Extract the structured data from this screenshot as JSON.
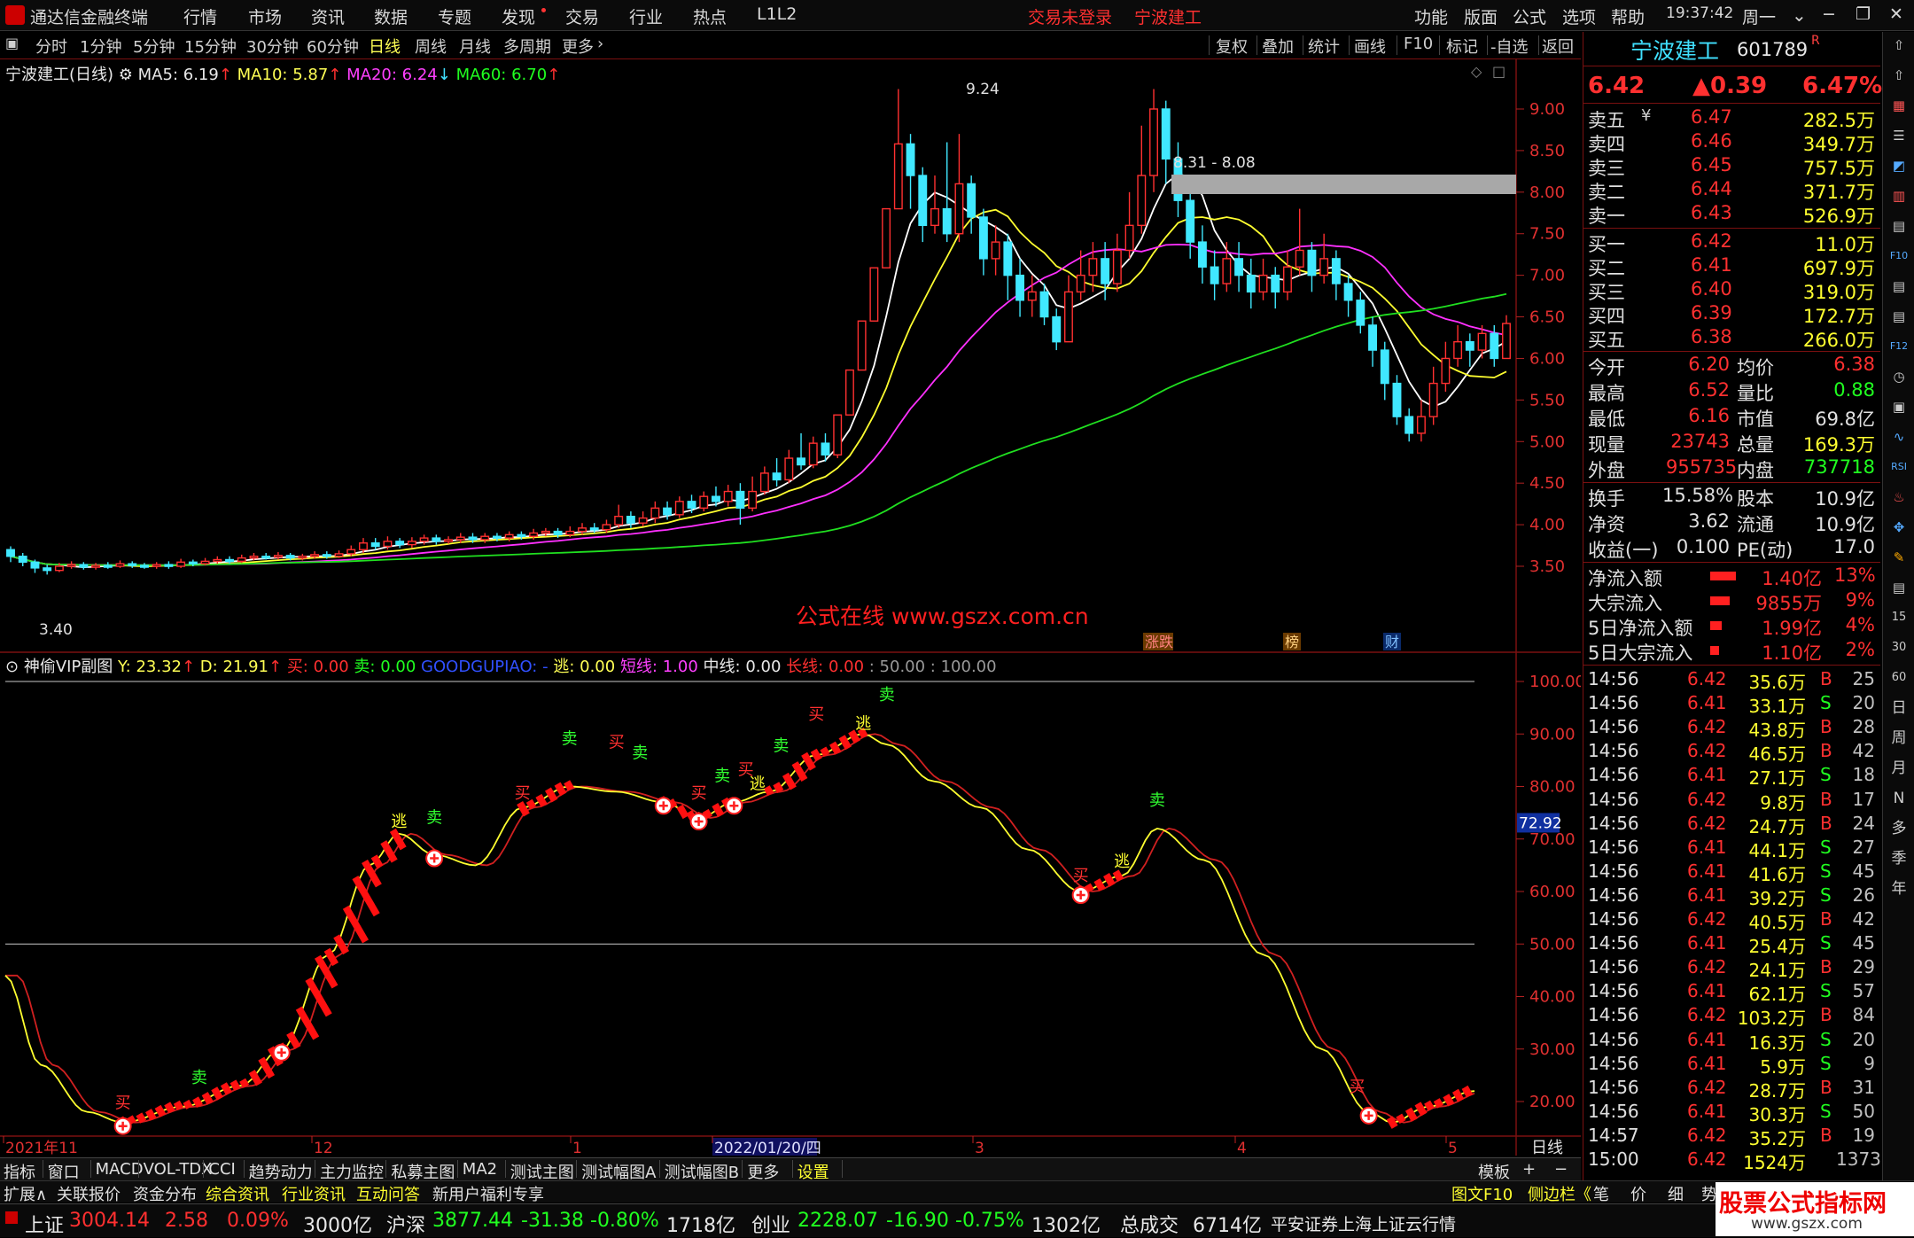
{
  "titlebar": {
    "app_name": "通达信金融终端",
    "menus": [
      "行情",
      "市场",
      "资讯",
      "数据",
      "专题",
      "发现",
      "交易",
      "行业",
      "热点",
      "L1L2"
    ],
    "login_status": "交易未登录",
    "stock_name": "宁波建工",
    "right_menus": [
      "功能",
      "版面",
      "公式",
      "选项",
      "帮助"
    ],
    "time": "19:37:42",
    "weekday": "周一"
  },
  "period_toolbar": {
    "items": [
      "分时",
      "1分钟",
      "5分钟",
      "15分钟",
      "30分钟",
      "60分钟",
      "日线",
      "周线",
      "月线",
      "多周期",
      "更多"
    ],
    "selected": "日线",
    "right_items": [
      "复权",
      "叠加",
      "统计",
      "画线",
      "F10",
      "标记",
      "-自选",
      "返回"
    ]
  },
  "main_legend": {
    "title": "宁波建工(日线)",
    "ma5": "MA5: 6.19",
    "ma10": "MA10: 5.87",
    "ma20": "MA20: 6.24",
    "ma60": "MA60: 6.70"
  },
  "main_chart": {
    "y_ticks": [
      "9.00",
      "8.50",
      "8.00",
      "7.50",
      "7.00",
      "6.50",
      "6.00",
      "5.50",
      "5.00",
      "4.50",
      "4.00",
      "3.50"
    ],
    "high_label": "9.24",
    "low_label": "3.40",
    "range_label": "8.31 - 8.08",
    "watermark": "公式在线  www.gszx.com.cn",
    "event_tags": [
      "涨跌",
      "榜",
      "财"
    ]
  },
  "sub_legend": {
    "title": "神偷VIP副图",
    "y": "Y: 23.32",
    "d": "D: 21.91",
    "buy": "买: 0.00",
    "sell": "卖: 0.00",
    "gg": "GOODGUPIAO: -",
    "escape": "逃: 0.00",
    "short": "短线: 1.00",
    "mid": "中线: 0.00",
    "long": "长线: 0.00",
    "levels": ": 50.00 : 100.00"
  },
  "sub_chart": {
    "y_ticks": [
      "100.00",
      "90.00",
      "80.00",
      "70.00",
      "60.00",
      "50.00",
      "40.00",
      "30.00",
      "20.00"
    ],
    "current_value": "72.92",
    "buy_text": "买",
    "sell_text": "卖",
    "escape_text": "逃"
  },
  "x_axis": {
    "labels": [
      "2021年11",
      "12",
      "1",
      "2022/01/20/四",
      "3",
      "4",
      "5"
    ],
    "period": "日线"
  },
  "chart_data": {
    "type": "candlestick",
    "title": "宁波建工(日线)",
    "y_range": [
      3.2,
      9.5
    ],
    "ma_values": {
      "MA5": 6.19,
      "MA10": 5.87,
      "MA20": 6.24,
      "MA60": 6.7
    },
    "extremes": {
      "high": 9.24,
      "low": 3.4
    },
    "candles": [
      [
        3.7,
        3.62,
        3.74,
        3.55
      ],
      [
        3.62,
        3.55,
        3.66,
        3.5
      ],
      [
        3.55,
        3.48,
        3.58,
        3.42
      ],
      [
        3.48,
        3.45,
        3.52,
        3.4
      ],
      [
        3.45,
        3.5,
        3.54,
        3.43
      ],
      [
        3.5,
        3.52,
        3.56,
        3.47
      ],
      [
        3.52,
        3.49,
        3.55,
        3.46
      ],
      [
        3.49,
        3.51,
        3.54,
        3.46
      ],
      [
        3.51,
        3.5,
        3.55,
        3.47
      ],
      [
        3.5,
        3.53,
        3.57,
        3.48
      ],
      [
        3.53,
        3.51,
        3.56,
        3.48
      ],
      [
        3.51,
        3.5,
        3.54,
        3.47
      ],
      [
        3.5,
        3.52,
        3.55,
        3.47
      ],
      [
        3.52,
        3.5,
        3.56,
        3.47
      ],
      [
        3.5,
        3.55,
        3.59,
        3.48
      ],
      [
        3.55,
        3.53,
        3.58,
        3.5
      ],
      [
        3.53,
        3.56,
        3.6,
        3.51
      ],
      [
        3.56,
        3.58,
        3.62,
        3.53
      ],
      [
        3.58,
        3.56,
        3.62,
        3.53
      ],
      [
        3.56,
        3.6,
        3.64,
        3.54
      ],
      [
        3.6,
        3.62,
        3.66,
        3.57
      ],
      [
        3.62,
        3.61,
        3.66,
        3.58
      ],
      [
        3.61,
        3.63,
        3.67,
        3.58
      ],
      [
        3.63,
        3.6,
        3.66,
        3.57
      ],
      [
        3.6,
        3.62,
        3.65,
        3.57
      ],
      [
        3.62,
        3.64,
        3.68,
        3.59
      ],
      [
        3.64,
        3.62,
        3.68,
        3.59
      ],
      [
        3.62,
        3.65,
        3.69,
        3.6
      ],
      [
        3.65,
        3.7,
        3.75,
        3.62
      ],
      [
        3.7,
        3.78,
        3.84,
        3.66
      ],
      [
        3.78,
        3.74,
        3.84,
        3.7
      ],
      [
        3.74,
        3.8,
        3.86,
        3.7
      ],
      [
        3.8,
        3.76,
        3.84,
        3.72
      ],
      [
        3.76,
        3.8,
        3.85,
        3.72
      ],
      [
        3.8,
        3.84,
        3.88,
        3.76
      ],
      [
        3.84,
        3.8,
        3.88,
        3.76
      ],
      [
        3.8,
        3.82,
        3.86,
        3.77
      ],
      [
        3.82,
        3.85,
        3.9,
        3.78
      ],
      [
        3.85,
        3.82,
        3.9,
        3.78
      ],
      [
        3.82,
        3.86,
        3.9,
        3.78
      ],
      [
        3.86,
        3.84,
        3.9,
        3.8
      ],
      [
        3.84,
        3.88,
        3.92,
        3.8
      ],
      [
        3.88,
        3.86,
        3.92,
        3.82
      ],
      [
        3.86,
        3.9,
        3.95,
        3.82
      ],
      [
        3.9,
        3.92,
        3.96,
        3.86
      ],
      [
        3.92,
        3.88,
        3.96,
        3.84
      ],
      [
        3.88,
        3.92,
        3.98,
        3.85
      ],
      [
        3.92,
        3.96,
        4.02,
        3.88
      ],
      [
        3.96,
        3.94,
        4.02,
        3.9
      ],
      [
        3.94,
        4.0,
        4.06,
        3.9
      ],
      [
        4.0,
        4.1,
        4.24,
        3.96
      ],
      [
        4.1,
        4.02,
        4.16,
        3.96
      ],
      [
        4.02,
        4.08,
        4.16,
        3.98
      ],
      [
        4.08,
        4.2,
        4.28,
        4.02
      ],
      [
        4.2,
        4.12,
        4.28,
        4.06
      ],
      [
        4.12,
        4.28,
        4.34,
        4.08
      ],
      [
        4.28,
        4.2,
        4.36,
        4.14
      ],
      [
        4.2,
        4.34,
        4.4,
        4.16
      ],
      [
        4.34,
        4.28,
        4.46,
        4.22
      ],
      [
        4.28,
        4.4,
        4.48,
        4.22
      ],
      [
        4.4,
        4.2,
        4.5,
        4.0
      ],
      [
        4.2,
        4.4,
        4.58,
        4.16
      ],
      [
        4.4,
        4.62,
        4.7,
        4.36
      ],
      [
        4.62,
        4.54,
        4.8,
        4.46
      ],
      [
        4.54,
        4.8,
        4.9,
        4.5
      ],
      [
        4.8,
        4.72,
        5.1,
        4.66
      ],
      [
        4.72,
        4.98,
        5.06,
        4.68
      ],
      [
        4.98,
        4.84,
        5.1,
        4.76
      ],
      [
        4.84,
        5.32,
        5.32,
        4.8
      ],
      [
        5.32,
        5.86,
        5.86,
        5.32
      ],
      [
        5.86,
        6.45,
        6.45,
        5.86
      ],
      [
        6.45,
        7.09,
        7.09,
        6.45
      ],
      [
        7.09,
        7.8,
        7.8,
        7.09
      ],
      [
        7.8,
        8.58,
        9.24,
        7.8
      ],
      [
        8.58,
        8.2,
        8.7,
        7.8
      ],
      [
        8.2,
        7.6,
        8.3,
        7.4
      ],
      [
        7.6,
        7.8,
        8.2,
        7.5
      ],
      [
        7.8,
        7.5,
        8.6,
        7.4
      ],
      [
        7.5,
        8.1,
        8.7,
        7.4
      ],
      [
        8.1,
        7.7,
        8.2,
        7.5
      ],
      [
        7.7,
        7.2,
        7.8,
        7.0
      ],
      [
        7.2,
        7.4,
        7.6,
        7.0
      ],
      [
        7.4,
        7.0,
        7.5,
        6.7
      ],
      [
        7.0,
        6.7,
        7.2,
        6.5
      ],
      [
        6.7,
        6.8,
        7.0,
        6.5
      ],
      [
        6.8,
        6.5,
        6.9,
        6.4
      ],
      [
        6.5,
        6.2,
        6.6,
        6.1
      ],
      [
        6.2,
        6.8,
        7.0,
        6.2
      ],
      [
        6.8,
        7.0,
        7.3,
        6.7
      ],
      [
        7.0,
        7.2,
        7.4,
        6.8
      ],
      [
        7.2,
        6.9,
        7.4,
        6.7
      ],
      [
        6.9,
        7.3,
        7.5,
        6.8
      ],
      [
        7.3,
        7.6,
        8.0,
        7.2
      ],
      [
        7.6,
        8.2,
        8.8,
        7.5
      ],
      [
        8.2,
        9.0,
        9.24,
        8.0
      ],
      [
        9.0,
        8.4,
        9.1,
        8.1
      ],
      [
        8.4,
        7.9,
        8.6,
        7.7
      ],
      [
        7.9,
        7.4,
        8.0,
        7.2
      ],
      [
        7.4,
        7.1,
        7.6,
        6.9
      ],
      [
        7.1,
        6.9,
        7.3,
        6.7
      ],
      [
        6.9,
        7.2,
        7.4,
        6.8
      ],
      [
        7.2,
        7.0,
        7.4,
        6.8
      ],
      [
        7.0,
        6.8,
        7.2,
        6.6
      ],
      [
        6.8,
        7.0,
        7.2,
        6.7
      ],
      [
        7.0,
        6.8,
        7.1,
        6.6
      ],
      [
        6.8,
        7.1,
        7.3,
        6.7
      ],
      [
        7.1,
        7.3,
        7.8,
        7.0
      ],
      [
        7.3,
        7.0,
        7.4,
        6.8
      ],
      [
        7.0,
        7.2,
        7.5,
        6.9
      ],
      [
        7.2,
        6.9,
        7.3,
        6.7
      ],
      [
        6.9,
        6.7,
        7.0,
        6.5
      ],
      [
        6.7,
        6.4,
        6.8,
        6.3
      ],
      [
        6.4,
        6.1,
        6.5,
        5.9
      ],
      [
        6.1,
        5.7,
        6.2,
        5.5
      ],
      [
        5.7,
        5.3,
        5.8,
        5.2
      ],
      [
        5.3,
        5.1,
        5.4,
        5.0
      ],
      [
        5.1,
        5.3,
        5.5,
        5.0
      ],
      [
        5.3,
        5.7,
        5.9,
        5.2
      ],
      [
        5.7,
        6.0,
        6.2,
        5.6
      ],
      [
        6.0,
        6.2,
        6.4,
        5.9
      ],
      [
        6.2,
        6.1,
        6.3,
        5.9
      ],
      [
        6.1,
        6.3,
        6.4,
        6.0
      ],
      [
        6.3,
        6.0,
        6.4,
        5.9
      ],
      [
        6.0,
        6.42,
        6.52,
        6.0
      ]
    ],
    "indicator": {
      "name": "神偷VIP副图",
      "y_range": [
        15,
        100
      ],
      "Y": 23.32,
      "D": 21.91,
      "levels": [
        50,
        100
      ]
    }
  },
  "quote_panel": {
    "name": "宁波建工",
    "code": "601789",
    "flag": "R",
    "price": "6.42",
    "change": "▲0.39",
    "change_pct": "6.47%",
    "asks": [
      {
        "label": "卖五",
        "price": "6.47",
        "vol": "282.5万"
      },
      {
        "label": "卖四",
        "price": "6.46",
        "vol": "349.7万"
      },
      {
        "label": "卖三",
        "price": "6.45",
        "vol": "757.5万"
      },
      {
        "label": "卖二",
        "price": "6.44",
        "vol": "371.7万"
      },
      {
        "label": "卖一",
        "price": "6.43",
        "vol": "526.9万"
      }
    ],
    "bids": [
      {
        "label": "买一",
        "price": "6.42",
        "vol": "11.0万"
      },
      {
        "label": "买二",
        "price": "6.41",
        "vol": "697.9万"
      },
      {
        "label": "买三",
        "price": "6.40",
        "vol": "319.0万"
      },
      {
        "label": "买四",
        "price": "6.39",
        "vol": "172.7万"
      },
      {
        "label": "买五",
        "price": "6.38",
        "vol": "266.0万"
      }
    ],
    "stats": [
      {
        "l1": "今开",
        "v1": "6.20",
        "l2": "均价",
        "v2": "6.38"
      },
      {
        "l1": "最高",
        "v1": "6.52",
        "l2": "量比",
        "v2": "0.88"
      },
      {
        "l1": "最低",
        "v1": "6.16",
        "l2": "市值",
        "v2": "69.8亿"
      },
      {
        "l1": "现量",
        "v1": "23743",
        "l2": "总量",
        "v2": "169.3万"
      },
      {
        "l1": "外盘",
        "v1": "955735",
        "l2": "内盘",
        "v2": "737718"
      }
    ],
    "fund": [
      {
        "l1": "换手",
        "v1": "15.58%",
        "l2": "股本",
        "v2": "10.9亿"
      },
      {
        "l1": "净资",
        "v1": "3.62",
        "l2": "流通",
        "v2": "10.9亿"
      },
      {
        "l1": "收益(一)",
        "v1": "0.100",
        "l2": "PE(动)",
        "v2": "17.0"
      }
    ],
    "flows": [
      {
        "label": "净流入额",
        "value": "1.40亿",
        "pct": "13%",
        "bar": 0.13
      },
      {
        "label": "大宗流入",
        "value": "9855万",
        "pct": "9%",
        "bar": 0.09
      },
      {
        "label": "5日净流入额",
        "value": "1.99亿",
        "pct": "4%",
        "bar": 0.04
      },
      {
        "label": "5日大宗流入",
        "value": "1.10亿",
        "pct": "2%",
        "bar": 0.02
      }
    ],
    "ticks": [
      {
        "t": "14:56",
        "p": "6.42",
        "v": "35.6万",
        "bs": "B",
        "n": "25"
      },
      {
        "t": "14:56",
        "p": "6.41",
        "v": "33.1万",
        "bs": "S",
        "n": "20"
      },
      {
        "t": "14:56",
        "p": "6.42",
        "v": "43.8万",
        "bs": "B",
        "n": "28"
      },
      {
        "t": "14:56",
        "p": "6.42",
        "v": "46.5万",
        "bs": "B",
        "n": "42"
      },
      {
        "t": "14:56",
        "p": "6.41",
        "v": "27.1万",
        "bs": "S",
        "n": "18"
      },
      {
        "t": "14:56",
        "p": "6.42",
        "v": "9.8万",
        "bs": "B",
        "n": "17"
      },
      {
        "t": "14:56",
        "p": "6.42",
        "v": "24.7万",
        "bs": "B",
        "n": "24"
      },
      {
        "t": "14:56",
        "p": "6.41",
        "v": "44.1万",
        "bs": "S",
        "n": "27"
      },
      {
        "t": "14:56",
        "p": "6.41",
        "v": "41.6万",
        "bs": "S",
        "n": "45"
      },
      {
        "t": "14:56",
        "p": "6.41",
        "v": "39.2万",
        "bs": "S",
        "n": "26"
      },
      {
        "t": "14:56",
        "p": "6.42",
        "v": "40.5万",
        "bs": "B",
        "n": "42"
      },
      {
        "t": "14:56",
        "p": "6.41",
        "v": "25.4万",
        "bs": "S",
        "n": "45"
      },
      {
        "t": "14:56",
        "p": "6.42",
        "v": "24.1万",
        "bs": "B",
        "n": "29"
      },
      {
        "t": "14:56",
        "p": "6.41",
        "v": "62.1万",
        "bs": "S",
        "n": "57"
      },
      {
        "t": "14:56",
        "p": "6.42",
        "v": "103.2万",
        "bs": "B",
        "n": "84"
      },
      {
        "t": "14:56",
        "p": "6.41",
        "v": "16.3万",
        "bs": "S",
        "n": "20"
      },
      {
        "t": "14:56",
        "p": "6.41",
        "v": "5.9万",
        "bs": "S",
        "n": "9"
      },
      {
        "t": "14:56",
        "p": "6.42",
        "v": "28.7万",
        "bs": "B",
        "n": "31"
      },
      {
        "t": "14:56",
        "p": "6.41",
        "v": "30.3万",
        "bs": "S",
        "n": "50"
      },
      {
        "t": "14:57",
        "p": "6.42",
        "v": "35.2万",
        "bs": "B",
        "n": "19"
      },
      {
        "t": "15:00",
        "p": "6.42",
        "v": "1524万",
        "bs": "",
        "n": "1373"
      }
    ]
  },
  "bottom_tabs": {
    "items": [
      "指标",
      "窗口",
      "MACD",
      "VOL-TDX",
      "CCI",
      "趋势动力",
      "主力监控",
      "私募主图",
      "MA2",
      "测试主图",
      "测试幅图A",
      "测试幅图B",
      "更多",
      "设置"
    ],
    "right": [
      "模板",
      "+",
      "−"
    ]
  },
  "info_tabs": {
    "items": [
      "扩展∧",
      "关联报价",
      "资金分布",
      "综合资讯",
      "行业资讯",
      "互动问答",
      "新用户福利专享"
    ],
    "right": [
      "图文F10",
      "侧边栏《",
      "笔",
      "价",
      "细",
      "势"
    ]
  },
  "status_bar": {
    "sh_name": "上证",
    "sh_val": "3004.14",
    "sh_chg": "2.58",
    "sh_pct": "0.09%",
    "sh_amt": "3000亿",
    "hs_name": "沪深",
    "hs_val": "3877.44",
    "hs_chg": "-31.38",
    "hs_pct": "-0.80%",
    "hs_amt": "1718亿",
    "cy_name": "创业",
    "cy_val": "2228.07",
    "cy_chg": "-16.90",
    "cy_pct": "-0.75%",
    "cy_amt": "1302亿",
    "total_name": "总成交",
    "total_amt": "6714亿",
    "source": "平安证券上海上证云行情",
    "brand": "股票公式指标网",
    "brand_url": "www.gszx.com"
  },
  "side_strip": [
    "日",
    "周",
    "月",
    "N",
    "多",
    "季",
    "年"
  ]
}
